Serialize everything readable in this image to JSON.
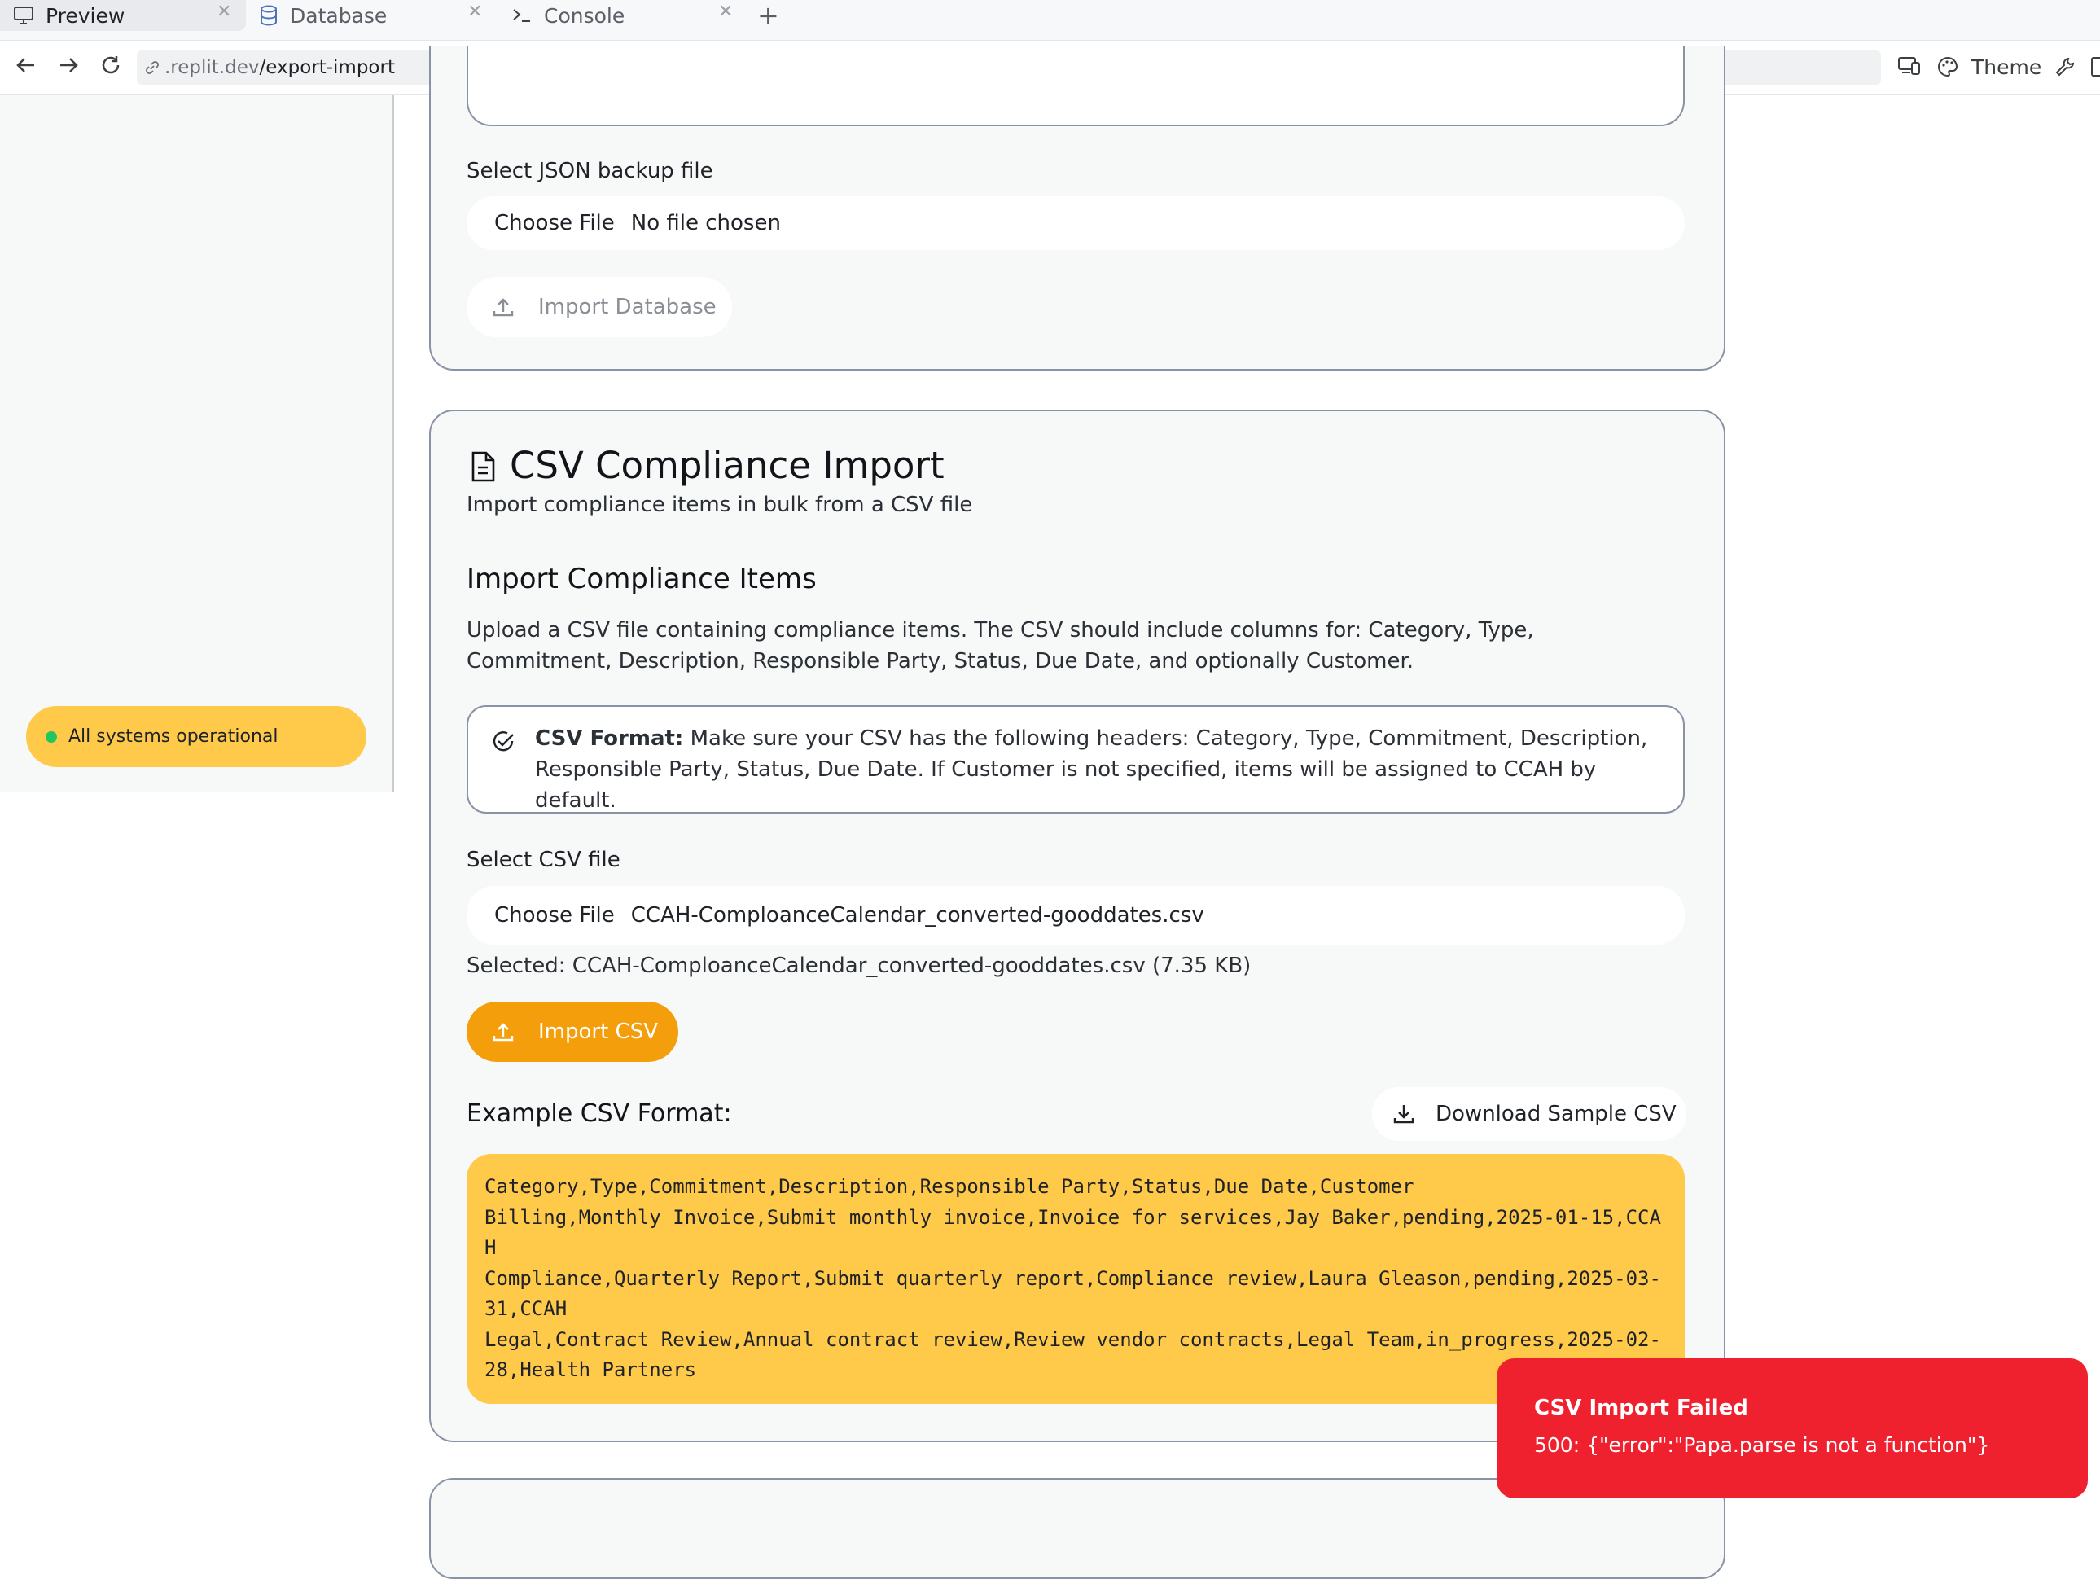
{
  "tabs": [
    {
      "label": "Preview",
      "icon": "monitor-icon"
    },
    {
      "label": "Database",
      "icon": "database-icon"
    },
    {
      "label": "Console",
      "icon": "terminal-icon"
    }
  ],
  "address": {
    "url_scheme": ".replit.dev",
    "url_path": "/export-import",
    "theme_label": "Theme"
  },
  "sidebar": {
    "status_text": "All systems operational"
  },
  "db_import": {
    "file_label": "Select JSON backup file",
    "choose_label": "Choose File",
    "file_value": "No file chosen",
    "import_button": "Import Database"
  },
  "csv_import": {
    "title": "CSV Compliance Import",
    "subtitle": "Import compliance items in bulk from a CSV file",
    "section_heading": "Import Compliance Items",
    "description": "Upload a CSV file containing compliance items. The CSV should include columns for: Category, Type, Commitment, Description, Responsible Party, Status, Due Date, and optionally Customer.",
    "format_note_bold": "CSV Format:",
    "format_note_text": " Make sure your CSV has the following headers: Category, Type, Commitment, Description, Responsible Party, Status, Due Date. If Customer is not specified, items will be assigned to CCAH by default.",
    "file_label": "Select CSV file",
    "choose_label": "Choose File",
    "file_value": "CCAH-ComploanceCalendar_converted-gooddates.csv",
    "selected_text": "Selected: CCAH-ComploanceCalendar_converted-gooddates.csv (7.35 KB)",
    "import_button": "Import CSV",
    "example_heading": "Example CSV Format:",
    "download_button": "Download Sample CSV",
    "example_csv": "Category,Type,Commitment,Description,Responsible Party,Status,Due Date,Customer\nBilling,Monthly Invoice,Submit monthly invoice,Invoice for services,Jay Baker,pending,2025-01-15,CCAH\nCompliance,Quarterly Report,Submit quarterly report,Compliance review,Laura Gleason,pending,2025-03-31,CCAH\nLegal,Contract Review,Annual contract review,Review vendor contracts,Legal Team,in_progress,2025-02-28,Health Partners"
  },
  "toast": {
    "title": "CSV Import Failed",
    "message": "500: {\"error\":\"Papa.parse is not a function\"}"
  },
  "colors": {
    "accent": "#f59e0b",
    "highlight": "#ffc94a",
    "error": "#f0212e",
    "status_ok": "#22c55e"
  }
}
